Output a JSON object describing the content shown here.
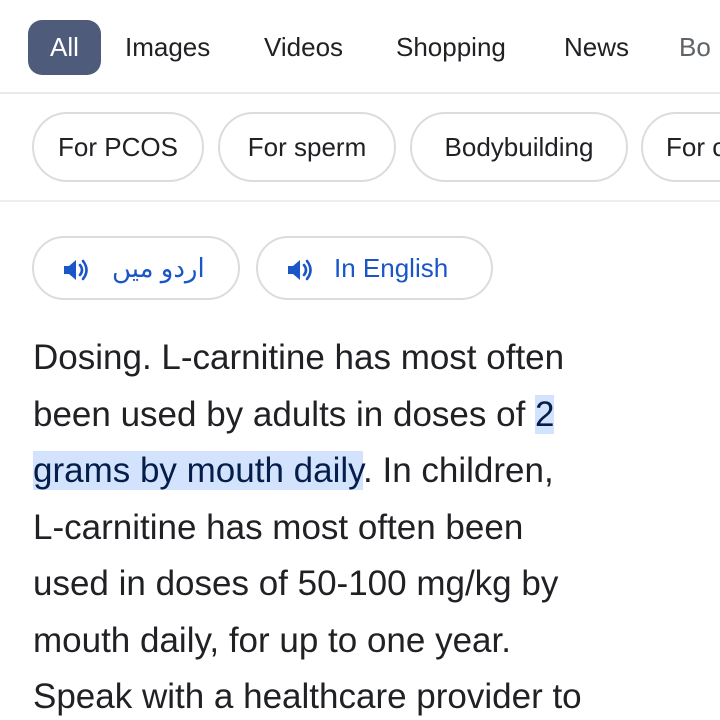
{
  "tabs": [
    {
      "label": "All",
      "active": true
    },
    {
      "label": "Images"
    },
    {
      "label": "Videos"
    },
    {
      "label": "Shopping"
    },
    {
      "label": "News"
    },
    {
      "label": "Bo"
    }
  ],
  "chips": [
    "For PCOS",
    "For sperm",
    "Bodybuilding",
    "For c"
  ],
  "language_buttons": {
    "urdu": {
      "label": "اردو میں",
      "icon": "speaker-icon"
    },
    "english": {
      "label": "In English",
      "icon": "speaker-icon"
    }
  },
  "snippet": {
    "line1": "Dosing. L-carnitine has most often",
    "line2_text": "been used by adults in doses of ",
    "line2_highlight": "2",
    "line3_highlight": "grams by mouth daily",
    "line3_text": ". In children,",
    "line4": "L-carnitine has most often been",
    "line5": "used in doses of 50-100 mg/kg by",
    "line6": "mouth daily, for up to one year.",
    "line7": "Speak with a healthcare provider to"
  },
  "colors": {
    "active_tab_bg": "#4e5b7a",
    "link_blue": "#1a56c8",
    "highlight_bg": "#d3e3fd",
    "highlight_text": "#041e49"
  }
}
